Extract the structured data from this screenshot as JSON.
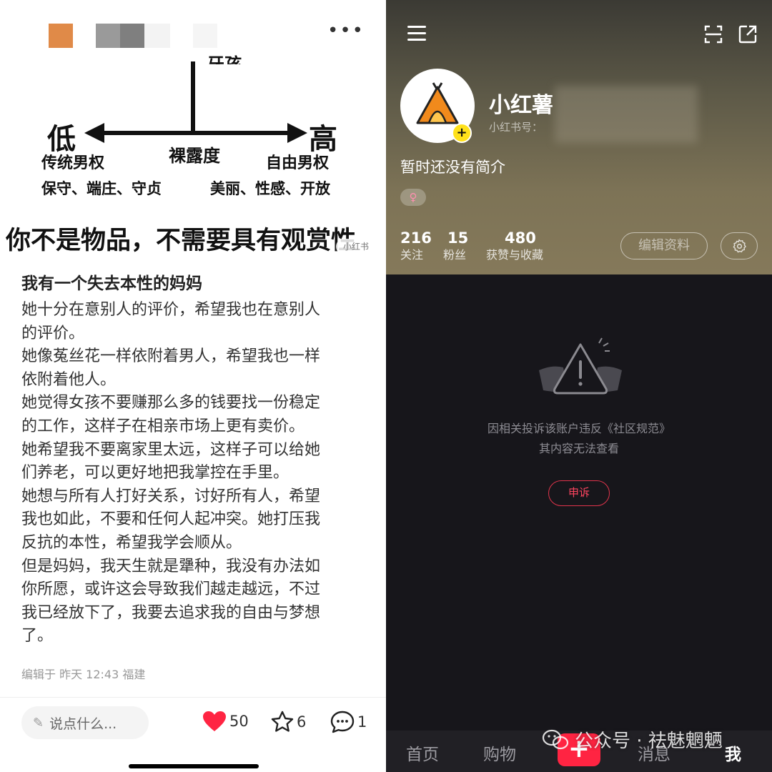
{
  "left": {
    "diagram": {
      "top_fragment": "牙孩",
      "low": "低",
      "high": "高",
      "axis_label": "裸露度",
      "left_title": "传统男权",
      "right_title": "自由男权",
      "left_traits": "保守、端庄、守贞",
      "right_traits": "美丽、性感、开放"
    },
    "headline": "你不是物品，不需要具有观赏性",
    "watermark": "小红书",
    "note": {
      "title": "我有一个失去本性的妈妈",
      "lines": [
        "她十分在意别人的评价，希望我也在意别人",
        "的评价。",
        "她像菟丝花一样依附着男人，希望我也一样",
        "依附着他人。",
        "她觉得女孩不要赚那么多的钱要找一份稳定",
        "的工作，这样子在相亲市场上更有卖价。",
        "她希望我不要离家里太远，这样子可以给她",
        "们养老，可以更好地把我掌控在手里。",
        "她想与所有人打好关系，讨好所有人，希望",
        "我也如此，不要和任何人起冲突。她打压我",
        "反抗的本性，希望我学会顺从。",
        "但是妈妈，我天生就是犟种，我没有办法如",
        "你所愿，或许这会导致我们越走越远，不过",
        "我已经放下了，我要去追求我的自由与梦想",
        "了。"
      ]
    },
    "edit_info": "编辑于 昨天 12:43 福建",
    "comment_placeholder": "说点什么...",
    "likes": "50",
    "stars": "6",
    "comments": "1",
    "colors": {
      "like": "#ff2442"
    }
  },
  "right": {
    "profile": {
      "name": "小红薯",
      "id_label": "小红书号：",
      "bio": "暂时还没有简介",
      "gender_icon": "♀"
    },
    "stats": [
      {
        "num": "216",
        "label": "关注"
      },
      {
        "num": "15",
        "label": "粉丝"
      },
      {
        "num": "480",
        "label": "获赞与收藏"
      }
    ],
    "edit_profile": "编辑资料",
    "notice_line1": "因相关投诉该账户违反《社区规范》",
    "notice_line2": "其内容无法查看",
    "appeal": "申诉",
    "tabs": [
      "首页",
      "购物",
      "消息",
      "我"
    ],
    "post_icon": "+",
    "watermark": "公众号 · 祛魅魍魉",
    "colors": {
      "accent": "#ff2442",
      "bg": "#17161b"
    }
  }
}
